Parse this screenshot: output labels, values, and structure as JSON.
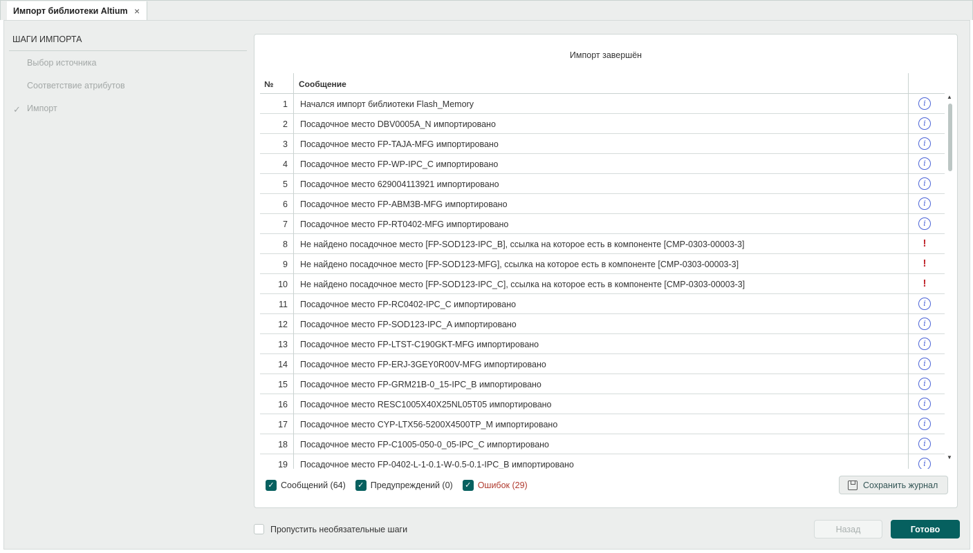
{
  "tab": {
    "title": "Импорт библиотеки Altium",
    "close_icon": "×"
  },
  "sidebar": {
    "title": "ШАГИ ИМПОРТА",
    "steps": [
      {
        "label": "Выбор источника"
      },
      {
        "label": "Соответствие атрибутов"
      },
      {
        "label": "Импорт",
        "done": true
      }
    ],
    "check": "✓"
  },
  "panel": {
    "title": "Импорт завершён",
    "columns": {
      "num": "№",
      "message": "Сообщение"
    },
    "rows": [
      {
        "n": "1",
        "msg": "Начался импорт библиотеки Flash_Memory",
        "type": "info"
      },
      {
        "n": "2",
        "msg": "Посадочное место DBV0005A_N импортировано",
        "type": "info"
      },
      {
        "n": "3",
        "msg": "Посадочное место FP-TAJA-MFG импортировано",
        "type": "info"
      },
      {
        "n": "4",
        "msg": "Посадочное место FP-WP-IPC_C импортировано",
        "type": "info"
      },
      {
        "n": "5",
        "msg": "Посадочное место 629004113921 импортировано",
        "type": "info"
      },
      {
        "n": "6",
        "msg": "Посадочное место FP-ABM3B-MFG импортировано",
        "type": "info"
      },
      {
        "n": "7",
        "msg": "Посадочное место FP-RT0402-MFG импортировано",
        "type": "info"
      },
      {
        "n": "8",
        "msg": "Не найдено посадочное место [FP-SOD123-IPC_B], ссылка на которое есть в компоненте [CMP-0303-00003-3]",
        "type": "error"
      },
      {
        "n": "9",
        "msg": "Не найдено посадочное место [FP-SOD123-MFG], ссылка на которое есть в компоненте [CMP-0303-00003-3]",
        "type": "error"
      },
      {
        "n": "10",
        "msg": "Не найдено посадочное место [FP-SOD123-IPC_C], ссылка на которое есть в компоненте [CMP-0303-00003-3]",
        "type": "error"
      },
      {
        "n": "11",
        "msg": "Посадочное место FP-RC0402-IPC_C импортировано",
        "type": "info"
      },
      {
        "n": "12",
        "msg": "Посадочное место FP-SOD123-IPC_A импортировано",
        "type": "info"
      },
      {
        "n": "13",
        "msg": "Посадочное место FP-LTST-C190GKT-MFG импортировано",
        "type": "info"
      },
      {
        "n": "14",
        "msg": "Посадочное место FP-ERJ-3GEY0R00V-MFG импортировано",
        "type": "info"
      },
      {
        "n": "15",
        "msg": "Посадочное место FP-GRM21B-0_15-IPC_B импортировано",
        "type": "info"
      },
      {
        "n": "16",
        "msg": "Посадочное место RESC1005X40X25NL05T05 импортировано",
        "type": "info"
      },
      {
        "n": "17",
        "msg": "Посадочное место CYP-LTX56-5200X4500TP_M импортировано",
        "type": "info"
      },
      {
        "n": "18",
        "msg": "Посадочное место FP-C1005-050-0_05-IPC_C импортировано",
        "type": "info"
      },
      {
        "n": "19",
        "msg": "Посадочное место FP-0402-L-1-0.1-W-0.5-0.1-IPC_B импортировано",
        "type": "info"
      }
    ],
    "filters": [
      {
        "label": "Сообщений (64)",
        "checked": true
      },
      {
        "label": "Предупреждений (0)",
        "checked": true
      },
      {
        "label": "Ошибок (29)",
        "checked": true,
        "color": "#b03a2e"
      }
    ],
    "save_label": "Сохранить журнал"
  },
  "footer": {
    "skip_label": "Пропустить необязательные шаги",
    "skip_checked": false,
    "back_label": "Назад",
    "done_label": "Готово"
  },
  "colors": {
    "accent": "#06605f",
    "info": "#4a63d6",
    "error": "#c0272d"
  }
}
